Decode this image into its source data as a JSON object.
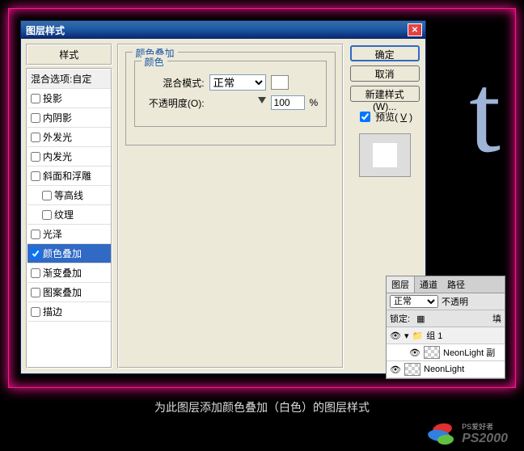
{
  "dialog": {
    "title": "图层样式",
    "styles_header": "样式",
    "blend_options": "混合选项:自定",
    "items": [
      {
        "label": "投影",
        "checked": false
      },
      {
        "label": "内阴影",
        "checked": false
      },
      {
        "label": "外发光",
        "checked": false
      },
      {
        "label": "内发光",
        "checked": false
      },
      {
        "label": "斜面和浮雕",
        "checked": false
      },
      {
        "label": "等高线",
        "checked": false,
        "sub": true
      },
      {
        "label": "纹理",
        "checked": false,
        "sub": true
      },
      {
        "label": "光泽",
        "checked": false
      },
      {
        "label": "颜色叠加",
        "checked": true,
        "active": true
      },
      {
        "label": "渐变叠加",
        "checked": false
      },
      {
        "label": "图案叠加",
        "checked": false
      },
      {
        "label": "描边",
        "checked": false
      }
    ],
    "section_title": "颜色叠加",
    "group_title": "颜色",
    "blend_mode_label": "混合模式:",
    "blend_mode_value": "正常",
    "opacity_label": "不透明度(O):",
    "opacity_value": "100",
    "opacity_unit": "%",
    "buttons": {
      "ok": "确定",
      "cancel": "取消",
      "new_style": "新建样式(W)..."
    },
    "preview_label_pre": "预览(",
    "preview_label_key": "V",
    "preview_label_post": ")",
    "preview_checked": true
  },
  "layers": {
    "tabs": [
      "图层",
      "通道",
      "路径"
    ],
    "blend_mode": "正常",
    "opacity_label": "不透明",
    "lock_label": "锁定:",
    "fill_label": "填",
    "items": [
      {
        "type": "group",
        "name": "组 1",
        "visible": true
      },
      {
        "type": "layer",
        "name": "NeonLight 副",
        "visible": true,
        "indent": true
      },
      {
        "type": "layer",
        "name": "NeonLight",
        "visible": true,
        "indent": false
      }
    ]
  },
  "caption": "为此图层添加颜色叠加（白色）的图层样式",
  "logo": {
    "small": "PS爱好者",
    "text": "PS2000"
  }
}
